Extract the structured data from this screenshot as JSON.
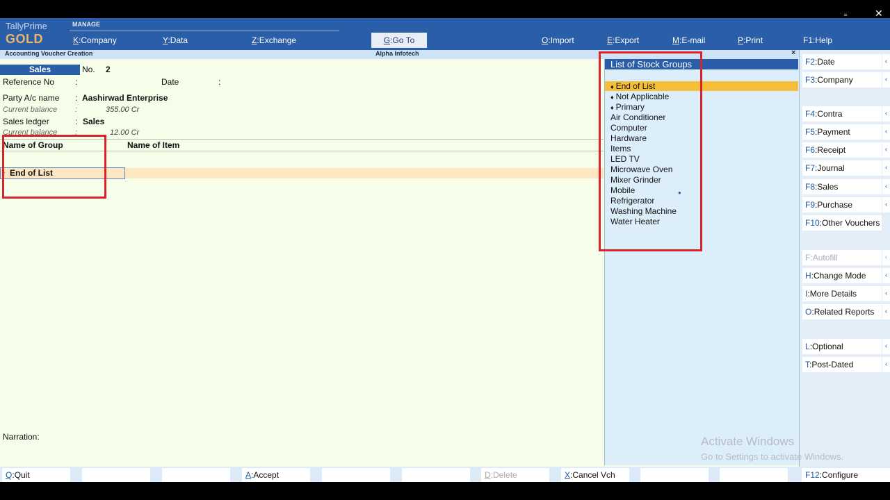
{
  "brand": {
    "line1": "TallyPrime",
    "line2": "GOLD"
  },
  "header": {
    "section": "MANAGE",
    "menu": [
      {
        "key": "K",
        "label": "Company"
      },
      {
        "key": "Y",
        "label": "Data"
      },
      {
        "key": "Z",
        "label": "Exchange"
      },
      {
        "key": "G",
        "label": "Go To"
      },
      {
        "key": "O",
        "label": "Import"
      },
      {
        "key": "E",
        "label": "Export"
      },
      {
        "key": "M",
        "label": "E-mail"
      },
      {
        "key": "P",
        "label": "Print"
      },
      {
        "key": "F1",
        "label": "Help"
      }
    ]
  },
  "subheader": {
    "screen_title": "Accounting Voucher Creation",
    "company": "Alpha Infotech",
    "close": "×"
  },
  "voucher": {
    "type": "Sales",
    "no_label": "No.",
    "no_value": "2",
    "reference_label": "Reference No",
    "date_label": "Date",
    "colon": ":",
    "party_label": "Party A/c name",
    "party_value": "Aashirwad Enterprise",
    "current_balance_label": "Current balance",
    "party_balance": "355.00 Cr",
    "sales_ledger_label": "Sales ledger",
    "sales_ledger_value": "Sales",
    "sales_balance": "12.00 Cr",
    "col_group": "Name of Group",
    "col_item": "Name of Item",
    "end_of_list": "End of List",
    "narration_label": "Narration:"
  },
  "stock_groups": {
    "title": "List of Stock Groups",
    "items": [
      {
        "label": "End of List",
        "bullet": "♦"
      },
      {
        "label": "Not Applicable",
        "bullet": "♦"
      },
      {
        "label": "Primary",
        "bullet": "♦"
      },
      {
        "label": "Air Conditioner",
        "bullet": ""
      },
      {
        "label": "Computer",
        "bullet": ""
      },
      {
        "label": "Hardware",
        "bullet": ""
      },
      {
        "label": "Items",
        "bullet": ""
      },
      {
        "label": "LED TV",
        "bullet": ""
      },
      {
        "label": "Microwave Oven",
        "bullet": ""
      },
      {
        "label": "Mixer Grinder",
        "bullet": ""
      },
      {
        "label": "Mobile",
        "bullet": ""
      },
      {
        "label": "Refrigerator",
        "bullet": ""
      },
      {
        "label": "Washing Machine",
        "bullet": ""
      },
      {
        "label": "Water Heater",
        "bullet": ""
      }
    ]
  },
  "right_buttons": [
    {
      "key": "F2",
      "label": "Date"
    },
    {
      "key": "F3",
      "label": "Company"
    },
    {
      "key": "F4",
      "label": "Contra"
    },
    {
      "key": "F5",
      "label": "Payment"
    },
    {
      "key": "F6",
      "label": "Receipt"
    },
    {
      "key": "F7",
      "label": "Journal"
    },
    {
      "key": "F8",
      "label": "Sales"
    },
    {
      "key": "F9",
      "label": "Purchase"
    },
    {
      "key": "F10",
      "label": "Other Vouchers"
    },
    {
      "key": "F",
      "label": "Autofill"
    },
    {
      "key": "H",
      "label": "Change Mode"
    },
    {
      "key": "I",
      "label": "More Details"
    },
    {
      "key": "O",
      "label": "Related Reports"
    },
    {
      "key": "L",
      "label": "Optional"
    },
    {
      "key": "T",
      "label": "Post-Dated"
    }
  ],
  "bottom_buttons": [
    {
      "key": "Q",
      "label": "Quit"
    },
    {
      "key": "A",
      "label": "Accept"
    },
    {
      "key": "D",
      "label": "Delete"
    },
    {
      "key": "X",
      "label": "Cancel Vch"
    },
    {
      "key": "F12",
      "label": "Configure"
    }
  ],
  "arrow_glyph": "‹",
  "watermark": {
    "line1": "Activate Windows",
    "line2": "Go to Settings to activate Windows."
  },
  "colors": {
    "header": "#2a5ea8",
    "highlight": "#f6bf3a",
    "annotation": "#d9232c",
    "body": "#f6fde9"
  }
}
